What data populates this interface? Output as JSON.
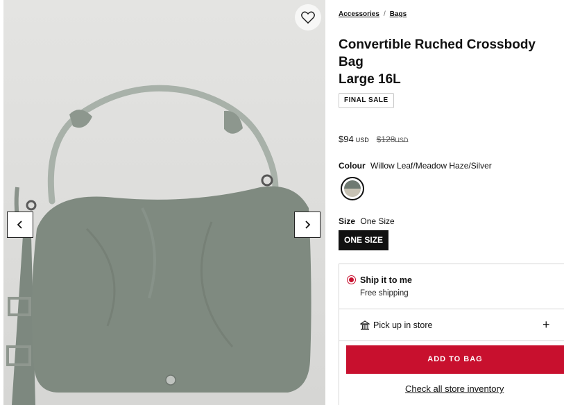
{
  "gallery": {
    "wishlist_icon": "heart-outline-icon",
    "prev_icon": "chevron-left-icon",
    "next_icon": "chevron-right-icon"
  },
  "breadcrumb": {
    "items": [
      "Accessories",
      "Bags"
    ],
    "separator": "/"
  },
  "product": {
    "title_lines": [
      "Convertible Ruched Crossbody",
      "Bag",
      "Large 16L"
    ],
    "badge": "FINAL SALE",
    "price": "$94",
    "currency": "USD",
    "original_price": "$128",
    "original_currency": "USD"
  },
  "colour": {
    "label": "Colour",
    "value": "Willow Leaf/Meadow Haze/Silver",
    "swatch_top_color": "#6f7a72",
    "swatch_bottom_color": "#c7c2b4"
  },
  "size": {
    "label": "Size",
    "value": "One Size",
    "button_label": "ONE SIZE"
  },
  "delivery": {
    "ship_title": "Ship it to me",
    "ship_subtitle": "Free shipping",
    "pickup_label": "Pick up in store",
    "pickup_icon": "store-icon",
    "expand_icon": "plus-icon"
  },
  "actions": {
    "add_to_bag": "ADD TO BAG",
    "store_inventory": "Check all store inventory"
  },
  "colors": {
    "accent": "#c8102e",
    "dark": "#111111"
  }
}
